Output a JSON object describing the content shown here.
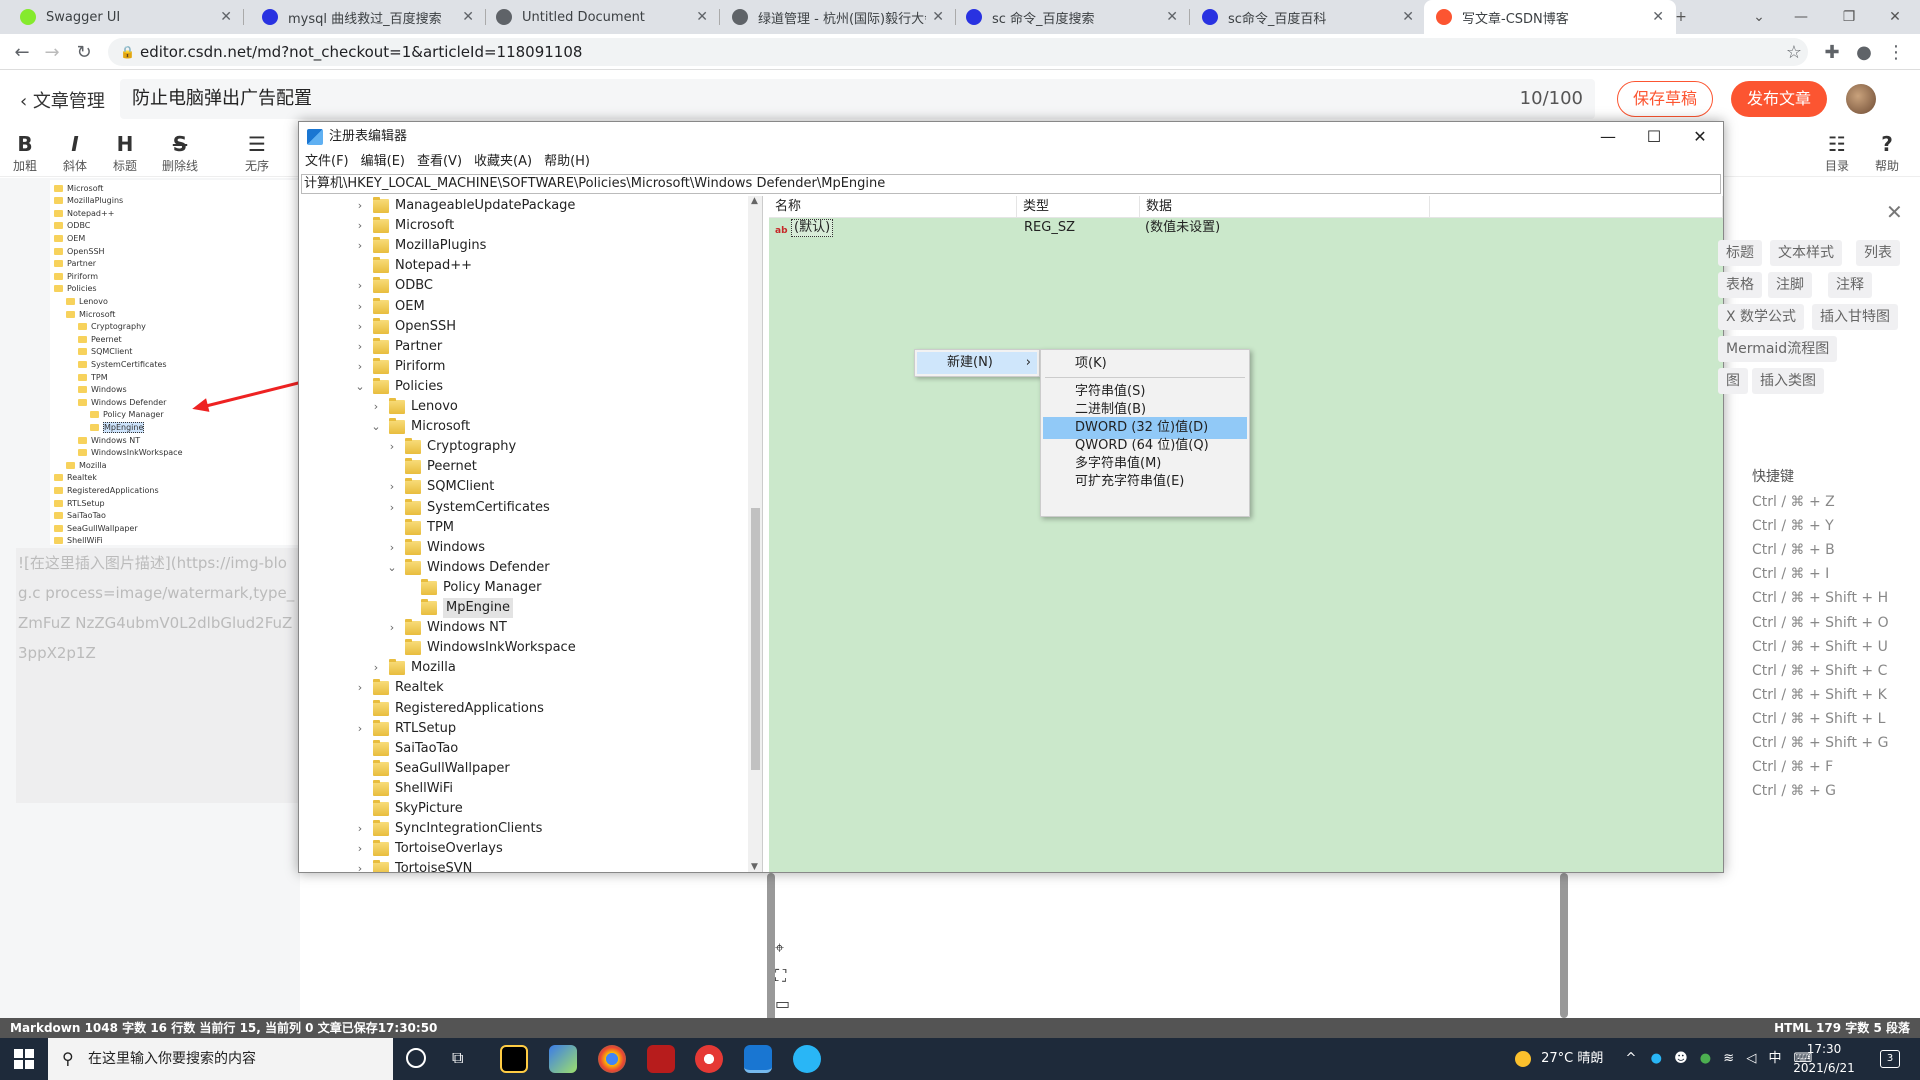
{
  "browser": {
    "tabs": [
      {
        "title": "Swagger UI",
        "favicon_color": "#85ea2d",
        "active": false
      },
      {
        "title": "mysql 曲线救过_百度搜索",
        "favicon_color": "#2932e1",
        "active": false
      },
      {
        "title": "Untitled Document",
        "favicon_color": "#5f6368",
        "active": false
      },
      {
        "title": "绿道管理 - 杭州(国际)毅行大会",
        "favicon_color": "#5f6368",
        "active": false
      },
      {
        "title": "sc 命令_百度搜索",
        "favicon_color": "#2932e1",
        "active": false
      },
      {
        "title": "sc命令_百度百科",
        "favicon_color": "#2932e1",
        "active": false
      },
      {
        "title": "写文章-CSDN博客",
        "favicon_color": "#fc5531",
        "active": true
      }
    ],
    "url": "editor.csdn.net/md?not_checkout=1&articleId=118091108"
  },
  "editor": {
    "back_label": "文章管理",
    "title": "防止电脑弹出广告配置",
    "title_count": "10/100",
    "save_draft": "保存草稿",
    "publish": "发布文章",
    "toolbar": [
      {
        "icon": "B",
        "label": "加粗"
      },
      {
        "icon": "I",
        "label": "斜体"
      },
      {
        "icon": "H",
        "label": "标题"
      },
      {
        "icon": "S",
        "label": "删除线"
      },
      {
        "icon": "☰",
        "label": "无序"
      }
    ],
    "toolbar_right": [
      {
        "icon": "☷",
        "label": "目录"
      },
      {
        "icon": "?",
        "label": "帮助"
      }
    ],
    "markdown_text": "![在这里插入图片描述](https://img-blog.c process=image/watermark,type_ZmFuZ NzZG4ubmV0L2dlbGlud2FuZ3ppX2p1Z"
  },
  "thumbnail_tree": [
    {
      "t": "Microsoft",
      "d": 0
    },
    {
      "t": "MozillaPlugins",
      "d": 0
    },
    {
      "t": "Notepad++",
      "d": 0
    },
    {
      "t": "ODBC",
      "d": 0
    },
    {
      "t": "OEM",
      "d": 0
    },
    {
      "t": "OpenSSH",
      "d": 0
    },
    {
      "t": "Partner",
      "d": 0
    },
    {
      "t": "Piriform",
      "d": 0
    },
    {
      "t": "Policies",
      "d": 0
    },
    {
      "t": "Lenovo",
      "d": 1
    },
    {
      "t": "Microsoft",
      "d": 1
    },
    {
      "t": "Cryptography",
      "d": 2
    },
    {
      "t": "Peernet",
      "d": 2
    },
    {
      "t": "SQMClient",
      "d": 2
    },
    {
      "t": "SystemCertificates",
      "d": 2
    },
    {
      "t": "TPM",
      "d": 2
    },
    {
      "t": "Windows",
      "d": 2
    },
    {
      "t": "Windows Defender",
      "d": 2
    },
    {
      "t": "Policy Manager",
      "d": 3
    },
    {
      "t": "MpEngine",
      "d": 3,
      "sel": true
    },
    {
      "t": "Windows NT",
      "d": 2
    },
    {
      "t": "WindowsInkWorkspace",
      "d": 2
    },
    {
      "t": "Mozilla",
      "d": 1
    },
    {
      "t": "Realtek",
      "d": 0
    },
    {
      "t": "RegisteredApplications",
      "d": 0
    },
    {
      "t": "RTLSetup",
      "d": 0
    },
    {
      "t": "SaiTaoTao",
      "d": 0
    },
    {
      "t": "SeaGullWallpaper",
      "d": 0
    },
    {
      "t": "ShellWiFi",
      "d": 0
    }
  ],
  "right_panel": {
    "chips": [
      "标题",
      "文本样式",
      "列表",
      "表格",
      "注脚",
      "注释",
      "X 数学公式",
      "插入甘特图",
      "Mermaid流程图",
      "图",
      "插入类图"
    ],
    "shortcut_title": "快捷键",
    "shortcuts": [
      "Ctrl / ⌘ + Z",
      "Ctrl / ⌘ + Y",
      "Ctrl / ⌘ + B",
      "Ctrl / ⌘ + I",
      "Ctrl / ⌘ + Shift + H",
      "Ctrl / ⌘ + Shift + O",
      "Ctrl / ⌘ + Shift + U",
      "Ctrl / ⌘ + Shift + C",
      "Ctrl / ⌘ + Shift + K",
      "Ctrl / ⌘ + Shift + L",
      "Ctrl / ⌘ + Shift + G",
      "Ctrl / ⌘ + F",
      "Ctrl / ⌘ + G"
    ]
  },
  "status": {
    "left": "Markdown  1048 字数  16 行数  当前行 15, 当前列 0  文章已保存17:30:50",
    "right": "HTML  179 字数  5 段落"
  },
  "regedit": {
    "title": "注册表编辑器",
    "menu": [
      "文件(F)",
      "编辑(E)",
      "查看(V)",
      "收藏夹(A)",
      "帮助(H)"
    ],
    "path": "计算机\\HKEY_LOCAL_MACHINE\\SOFTWARE\\Policies\\Microsoft\\Windows Defender\\MpEngine",
    "tree": [
      {
        "t": "ManageableUpdatePackage",
        "d": 0,
        "ex": ">"
      },
      {
        "t": "Microsoft",
        "d": 0,
        "ex": ">"
      },
      {
        "t": "MozillaPlugins",
        "d": 0,
        "ex": ">"
      },
      {
        "t": "Notepad++",
        "d": 0,
        "ex": ""
      },
      {
        "t": "ODBC",
        "d": 0,
        "ex": ">"
      },
      {
        "t": "OEM",
        "d": 0,
        "ex": ">"
      },
      {
        "t": "OpenSSH",
        "d": 0,
        "ex": ">"
      },
      {
        "t": "Partner",
        "d": 0,
        "ex": ">"
      },
      {
        "t": "Piriform",
        "d": 0,
        "ex": ">"
      },
      {
        "t": "Policies",
        "d": 0,
        "ex": "v"
      },
      {
        "t": "Lenovo",
        "d": 1,
        "ex": ">"
      },
      {
        "t": "Microsoft",
        "d": 1,
        "ex": "v"
      },
      {
        "t": "Cryptography",
        "d": 2,
        "ex": ">"
      },
      {
        "t": "Peernet",
        "d": 2,
        "ex": ""
      },
      {
        "t": "SQMClient",
        "d": 2,
        "ex": ">"
      },
      {
        "t": "SystemCertificates",
        "d": 2,
        "ex": ">"
      },
      {
        "t": "TPM",
        "d": 2,
        "ex": ""
      },
      {
        "t": "Windows",
        "d": 2,
        "ex": ">"
      },
      {
        "t": "Windows Defender",
        "d": 2,
        "ex": "v"
      },
      {
        "t": "Policy Manager",
        "d": 3,
        "ex": ""
      },
      {
        "t": "MpEngine",
        "d": 3,
        "ex": "",
        "sel": true
      },
      {
        "t": "Windows NT",
        "d": 2,
        "ex": ">"
      },
      {
        "t": "WindowsInkWorkspace",
        "d": 2,
        "ex": ""
      },
      {
        "t": "Mozilla",
        "d": 1,
        "ex": ">"
      },
      {
        "t": "Realtek",
        "d": 0,
        "ex": ">"
      },
      {
        "t": "RegisteredApplications",
        "d": 0,
        "ex": ""
      },
      {
        "t": "RTLSetup",
        "d": 0,
        "ex": ">"
      },
      {
        "t": "SaiTaoTao",
        "d": 0,
        "ex": ""
      },
      {
        "t": "SeaGullWallpaper",
        "d": 0,
        "ex": ""
      },
      {
        "t": "ShellWiFi",
        "d": 0,
        "ex": ""
      },
      {
        "t": "SkyPicture",
        "d": 0,
        "ex": ""
      },
      {
        "t": "SyncIntegrationClients",
        "d": 0,
        "ex": ">"
      },
      {
        "t": "TortoiseOverlays",
        "d": 0,
        "ex": ">"
      },
      {
        "t": "TortoiseSVN",
        "d": 0,
        "ex": ">"
      }
    ],
    "columns": [
      "名称",
      "类型",
      "数据"
    ],
    "values": [
      {
        "name": "(默认)",
        "type": "REG_SZ",
        "data": "(数值未设置)"
      }
    ],
    "ctx_new": "新建(N)",
    "ctx_sub": [
      "项(K)",
      "字符串值(S)",
      "二进制值(B)",
      "DWORD (32 位)值(D)",
      "QWORD (64 位)值(Q)",
      "多字符串值(M)",
      "可扩充字符串值(E)"
    ],
    "ctx_highlight": "DWORD (32 位)值(D)"
  },
  "taskbar": {
    "search_placeholder": "在这里输入你要搜索的内容",
    "weather": "27°C 晴朗",
    "ime": "中",
    "time": "17:30",
    "date": "2021/6/21",
    "notifications": "3"
  }
}
